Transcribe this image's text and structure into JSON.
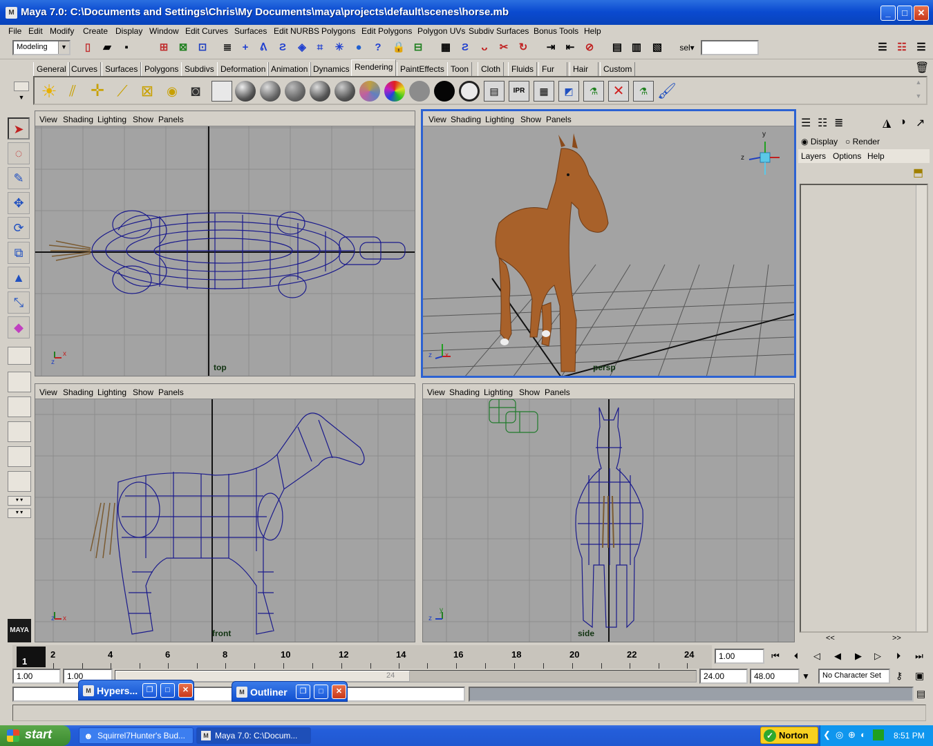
{
  "window": {
    "title": "Maya 7.0: C:\\Documents and Settings\\Chris\\My Documents\\maya\\projects\\default\\scenes\\horse.mb",
    "app_icon": "maya-icon"
  },
  "menubar": [
    "File",
    "Edit",
    "Modify",
    "Create",
    "Display",
    "Window",
    "Edit Curves",
    "Surfaces",
    "Edit NURBS",
    "Polygons",
    "Edit Polygons",
    "Polygon UVs",
    "Subdiv Surfaces",
    "Bonus Tools",
    "Help"
  ],
  "toolbar": {
    "mode": "Modeling",
    "sel_label": "sel▾",
    "sel_value": ""
  },
  "shelf_tabs": [
    "General",
    "Curves",
    "Surfaces",
    "Polygons",
    "Subdivs",
    "Deformation",
    "Animation",
    "Dynamics",
    "Rendering",
    "PaintEffects",
    "Toon",
    "Cloth",
    "Fluids",
    "Fur",
    "Hair",
    "Custom"
  ],
  "active_shelf_tab": "Rendering",
  "viewport_menu": [
    "View",
    "Shading",
    "Lighting",
    "Show",
    "Panels"
  ],
  "viewports": [
    {
      "camera": "top"
    },
    {
      "camera": "persp"
    },
    {
      "camera": "front"
    },
    {
      "camera": "side"
    }
  ],
  "axis_labels": {
    "x": "x",
    "y": "y",
    "z": "z"
  },
  "right_panel": {
    "display_label": "Display",
    "render_label": "Render",
    "menu": [
      "Layers",
      "Options",
      "Help"
    ],
    "scroll_left": "<<",
    "scroll_right": ">>"
  },
  "timeline": {
    "ticks": [
      "2",
      "4",
      "6",
      "8",
      "10",
      "12",
      "14",
      "16",
      "18",
      "20",
      "22",
      "24"
    ],
    "current_frame": "1",
    "current_time": "1.00"
  },
  "range": {
    "start_time": "1.00",
    "playback_start": "1.00",
    "slider_end": "24",
    "playback_end": "24.00",
    "end_time": "48.00",
    "character_set": "No Character Set"
  },
  "floating_windows": [
    {
      "title": "Hypers..."
    },
    {
      "title": "Outliner"
    }
  ],
  "taskbar": {
    "start": "start",
    "tasks": [
      "Squirrel7Hunter's Bud...",
      "Maya 7.0: C:\\Docum..."
    ],
    "norton": "Norton",
    "clock": "8:51 PM"
  },
  "maya_logo": "MAYA"
}
